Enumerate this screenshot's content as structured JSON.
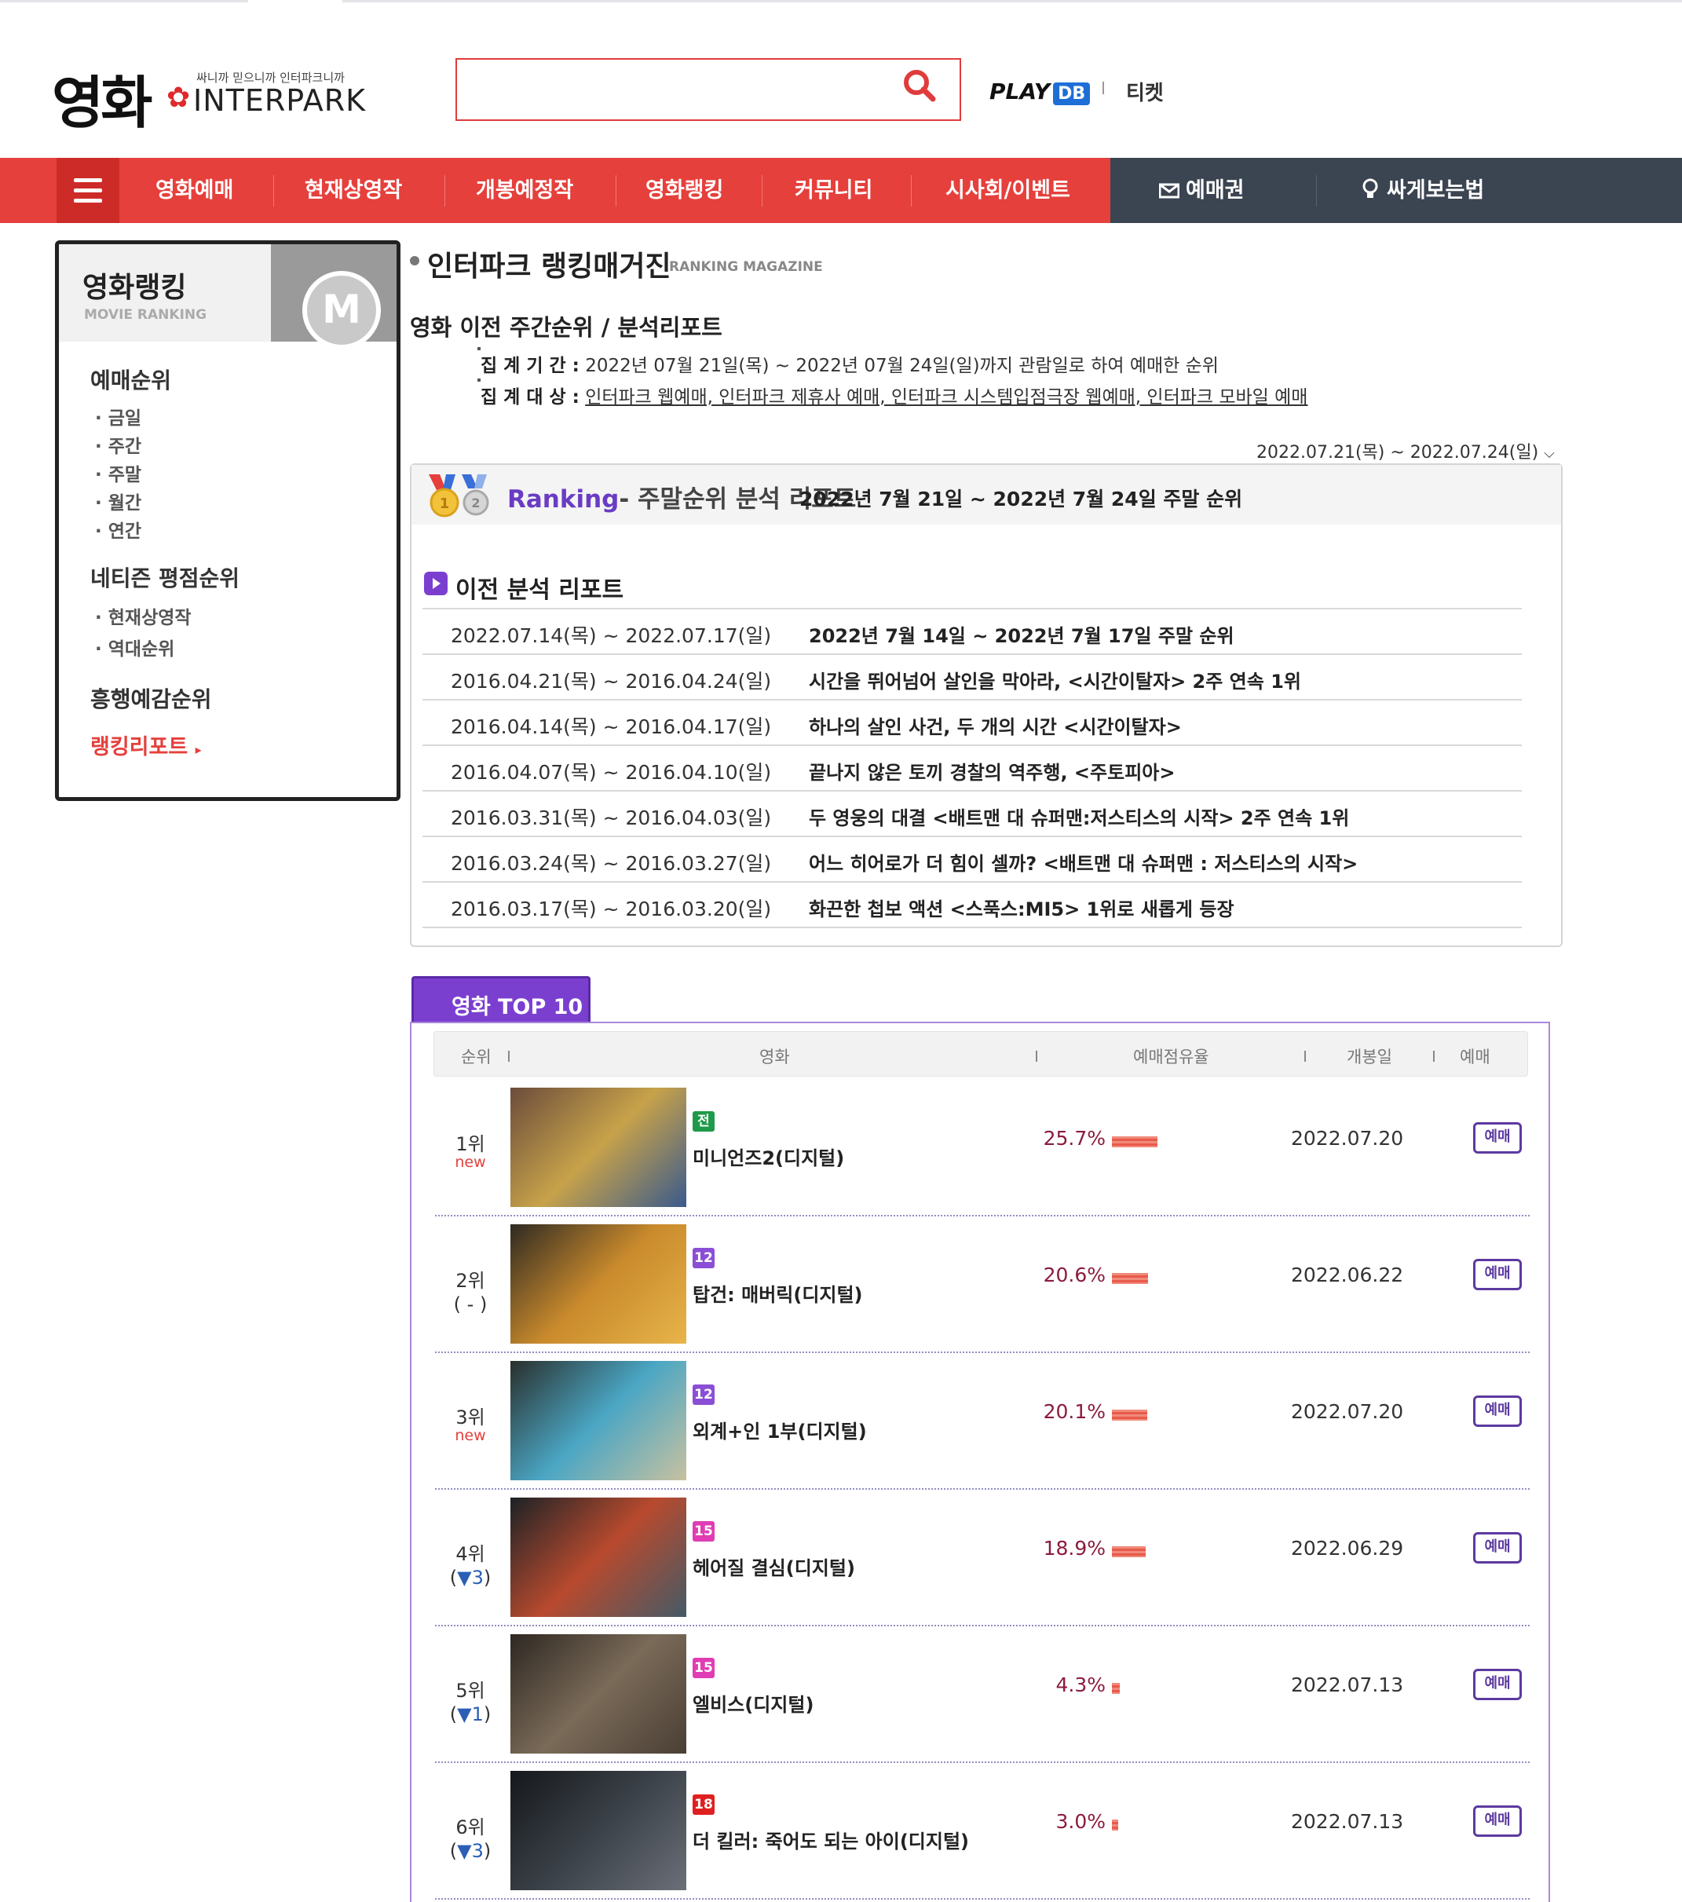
{
  "header": {
    "logo_main": "영화",
    "logo_tagline": "싸니까 믿으니까 인터파크니까",
    "logo_brand": "INTERPARK",
    "search_placeholder": "",
    "playdb": "PLAY",
    "playdb_badge": "DB",
    "ticket": "티켓"
  },
  "gnb": {
    "items": [
      "영화예매",
      "현재상영작",
      "개봉예정작",
      "영화랭킹",
      "커뮤니티",
      "시사회/이벤트"
    ],
    "voucher": "예매권",
    "tips": "싸게보는법"
  },
  "sidebar": {
    "title": "영화랭킹",
    "subtitle": "MOVIE RANKING",
    "medal_letter": "M",
    "sections": [
      {
        "label": "예매순위",
        "links": [
          "금일",
          "주간",
          "주말",
          "월간",
          "연간"
        ]
      },
      {
        "label": "네티즌 평점순위",
        "links": [
          "현재상영작",
          "역대순위"
        ]
      },
      {
        "label": "흥행예감순위",
        "links": []
      }
    ],
    "report_link": "랭킹리포트"
  },
  "main": {
    "title": "인터파크 랭킹매거진",
    "title_en": "RANKING MAGAZINE",
    "subtitle": "영화 이전 주간순위 / 분석리포트",
    "period_label": "집 계 기 간 :",
    "period_value": "2022년 07월 21일(목) ~ 2022년 07월 24일(일)까지 관람일로 하여 예매한 순위",
    "target_label": "집 계 대 상 :",
    "target_value": "인터파크 웹예매, 인터파크 제휴사 예매, 인터파크 시스템입점극장 웹예매, 인터파크 모바일 예매",
    "date_select": "2022.07.21(목) ~ 2022.07.24(일)"
  },
  "report": {
    "ranking_word": "Ranking",
    "ranking_rest": "- 주말순위 분석 리포트",
    "week_title": "2022년 7월 21일 ~ 2022년 7월 24일 주말 순위",
    "prev_title": "이전 분석 리포트",
    "prev": [
      {
        "date": "2022.07.14(목) ~ 2022.07.17(일)",
        "desc": "2022년 7월 14일 ~ 2022년 7월 17일 주말 순위"
      },
      {
        "date": "2016.04.21(목) ~ 2016.04.24(일)",
        "desc": "시간을 뛰어넘어 살인을 막아라, <시간이탈자> 2주 연속 1위"
      },
      {
        "date": "2016.04.14(목) ~ 2016.04.17(일)",
        "desc": "하나의 살인 사건, 두 개의 시간 <시간이탈자>"
      },
      {
        "date": "2016.04.07(목) ~ 2016.04.10(일)",
        "desc": "끝나지 않은 토끼 경찰의 역주행, <주토피아>"
      },
      {
        "date": "2016.03.31(목) ~ 2016.04.03(일)",
        "desc": "두 영웅의 대결 <배트맨 대 슈퍼맨:저스티스의 시작> 2주 연속 1위"
      },
      {
        "date": "2016.03.24(목) ~ 2016.03.27(일)",
        "desc": "어느 히어로가 더 힘이 셀까? <배트맨 대 슈퍼맨 : 저스티스의 시작>"
      },
      {
        "date": "2016.03.17(목) ~ 2016.03.20(일)",
        "desc": "화끈한 첩보 액션 <스푹스:MI5> 1위로 새롭게 등장"
      }
    ]
  },
  "top10": {
    "tab": "영화 TOP 10",
    "headers": {
      "rank": "순위",
      "movie": "영화",
      "share": "예매점유율",
      "open": "개봉일",
      "book": "예매"
    },
    "book_label": "예매",
    "rows": [
      {
        "rank": "1위",
        "change": "new",
        "change_type": "new",
        "age": "전",
        "age_color": "#1f9a4a",
        "title": "미니언즈2(디지털)",
        "share": "25.7%",
        "share_value": 25.7,
        "open": "2022.07.20",
        "poster_colors": [
          "#6b4c3b",
          "#c7a24a",
          "#3a5a8c"
        ]
      },
      {
        "rank": "2위",
        "change": "( - )",
        "change_type": "same",
        "age": "12",
        "age_color": "#8a4fd6",
        "title": "탑건: 매버릭(디지털)",
        "share": "20.6%",
        "share_value": 20.6,
        "open": "2022.06.22",
        "poster_colors": [
          "#2e2a22",
          "#c98a2c",
          "#e7b44a"
        ]
      },
      {
        "rank": "3위",
        "change": "new",
        "change_type": "new",
        "age": "12",
        "age_color": "#8a4fd6",
        "title": "외계+인 1부(디지털)",
        "share": "20.1%",
        "share_value": 20.1,
        "open": "2022.07.20",
        "poster_colors": [
          "#2a2f2c",
          "#4aa6c4",
          "#c8c1a0"
        ]
      },
      {
        "rank": "4위",
        "change_prefix": "(",
        "change_arrow": "▼3",
        "change_suffix": ")",
        "change_type": "down",
        "age": "15",
        "age_color": "#e03db5",
        "title": "헤어질 결심(디지털)",
        "share": "18.9%",
        "share_value": 18.9,
        "open": "2022.06.29",
        "poster_colors": [
          "#1c2226",
          "#b84a2e",
          "#445a66"
        ]
      },
      {
        "rank": "5위",
        "change_prefix": "(",
        "change_arrow": "▼1",
        "change_suffix": ")",
        "change_type": "down",
        "age": "15",
        "age_color": "#e03db5",
        "title": "엘비스(디지털)",
        "share": "4.3%",
        "share_value": 4.3,
        "open": "2022.07.13",
        "poster_colors": [
          "#2e2822",
          "#7a6a58",
          "#4a3f35"
        ]
      },
      {
        "rank": "6위",
        "change_prefix": "(",
        "change_arrow": "▼3",
        "change_suffix": ")",
        "change_type": "down",
        "age": "18",
        "age_color": "#e02020",
        "title": "더 킬러: 죽어도 되는 아이(디지털)",
        "share": "3.0%",
        "share_value": 3.0,
        "open": "2022.07.13",
        "poster_colors": [
          "#15181c",
          "#3b4148",
          "#6b7078"
        ]
      }
    ]
  }
}
